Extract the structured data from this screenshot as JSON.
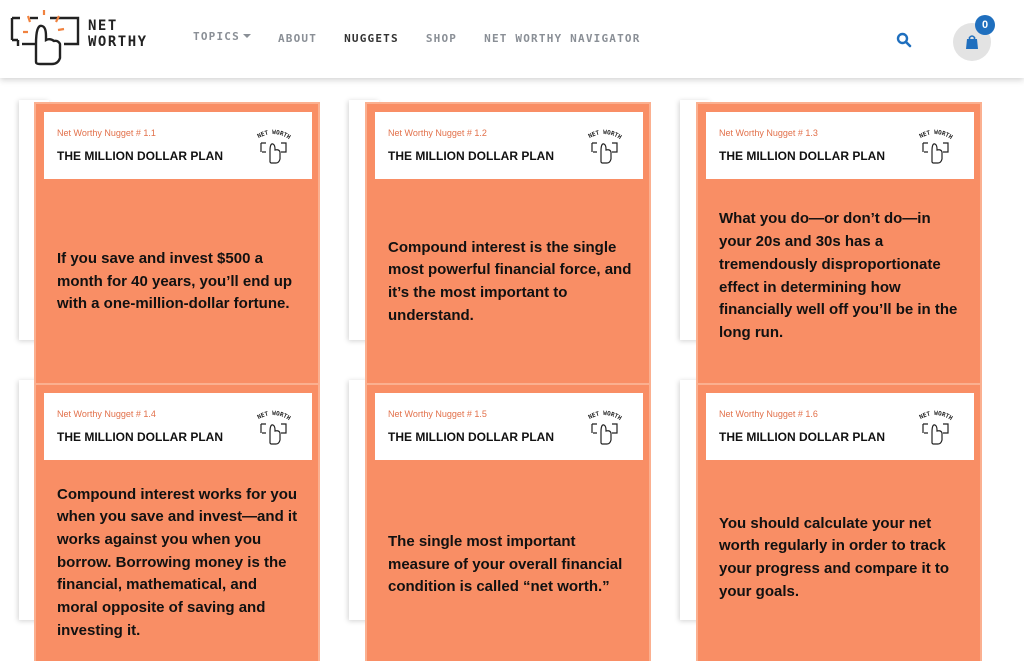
{
  "brand": {
    "name_line1": "NET",
    "name_line2": "WORTHY"
  },
  "nav": {
    "topics": "TOPICS",
    "about": "ABOUT",
    "nuggets": "NUGGETS",
    "shop": "SHOP",
    "navigator": "NET WORTHY NAVIGATOR"
  },
  "cart": {
    "count": "0"
  },
  "colors": {
    "accent": "#f98e65",
    "label": "#e2704a",
    "badge": "#1f6fbe"
  },
  "card_logo_text": "NET WORTHY",
  "cards": [
    {
      "label": "Net Worthy Nugget # 1.1",
      "title": "THE MILLION DOLLAR PLAN",
      "text": "If you save and invest $500 a month for 40 years, you’ll end up with a one-million-dollar fortune."
    },
    {
      "label": "Net Worthy Nugget # 1.2",
      "title": "THE MILLION DOLLAR PLAN",
      "text": "Compound interest is the single most powerful financial force, and it’s the most important to understand."
    },
    {
      "label": "Net Worthy Nugget # 1.3",
      "title": "THE MILLION DOLLAR PLAN",
      "text": "What you do—or don’t do—in your 20s and 30s has a tremendously disproportionate effect in determining how financially well off you’ll be in the long run."
    },
    {
      "label": "Net Worthy Nugget # 1.4",
      "title": "THE MILLION DOLLAR PLAN",
      "text": "Compound interest works for you when you save and invest—and it works against you when you borrow. Borrowing money is the financial, mathematical, and moral opposite of saving and investing it."
    },
    {
      "label": "Net Worthy Nugget # 1.5",
      "title": "THE MILLION DOLLAR PLAN",
      "text": "The single most important measure of your overall financial condition is called “net worth.”"
    },
    {
      "label": "Net Worthy Nugget # 1.6",
      "title": "THE MILLION DOLLAR PLAN",
      "text": "You should calculate your net worth regularly in order to track your progress and compare it to your goals."
    }
  ]
}
